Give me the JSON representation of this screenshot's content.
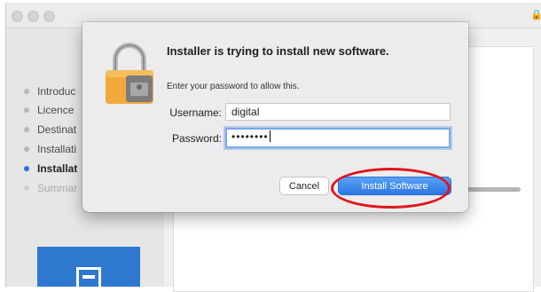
{
  "window": {
    "sidebar_steps": [
      {
        "label": "Introduc",
        "state": "done"
      },
      {
        "label": "Licence",
        "state": "done"
      },
      {
        "label": "Destinat",
        "state": "done"
      },
      {
        "label": "Installati",
        "state": "done"
      },
      {
        "label": "Installat",
        "state": "active"
      },
      {
        "label": "Summar",
        "state": "pending"
      }
    ],
    "accent_color": "#2f6fd6",
    "logo_color": "#2f78d0"
  },
  "dialog": {
    "title": "Installer is trying to install new software.",
    "message": "Enter your password to allow this.",
    "username_label": "Username:",
    "username_value": "digital",
    "password_label": "Password:",
    "password_value": "••••••••",
    "cancel_label": "Cancel",
    "install_label": "Install Software",
    "icon": "padlock-icon"
  },
  "annotation": {
    "highlight_color": "#e0141d",
    "highlight_target": "Install Software"
  }
}
